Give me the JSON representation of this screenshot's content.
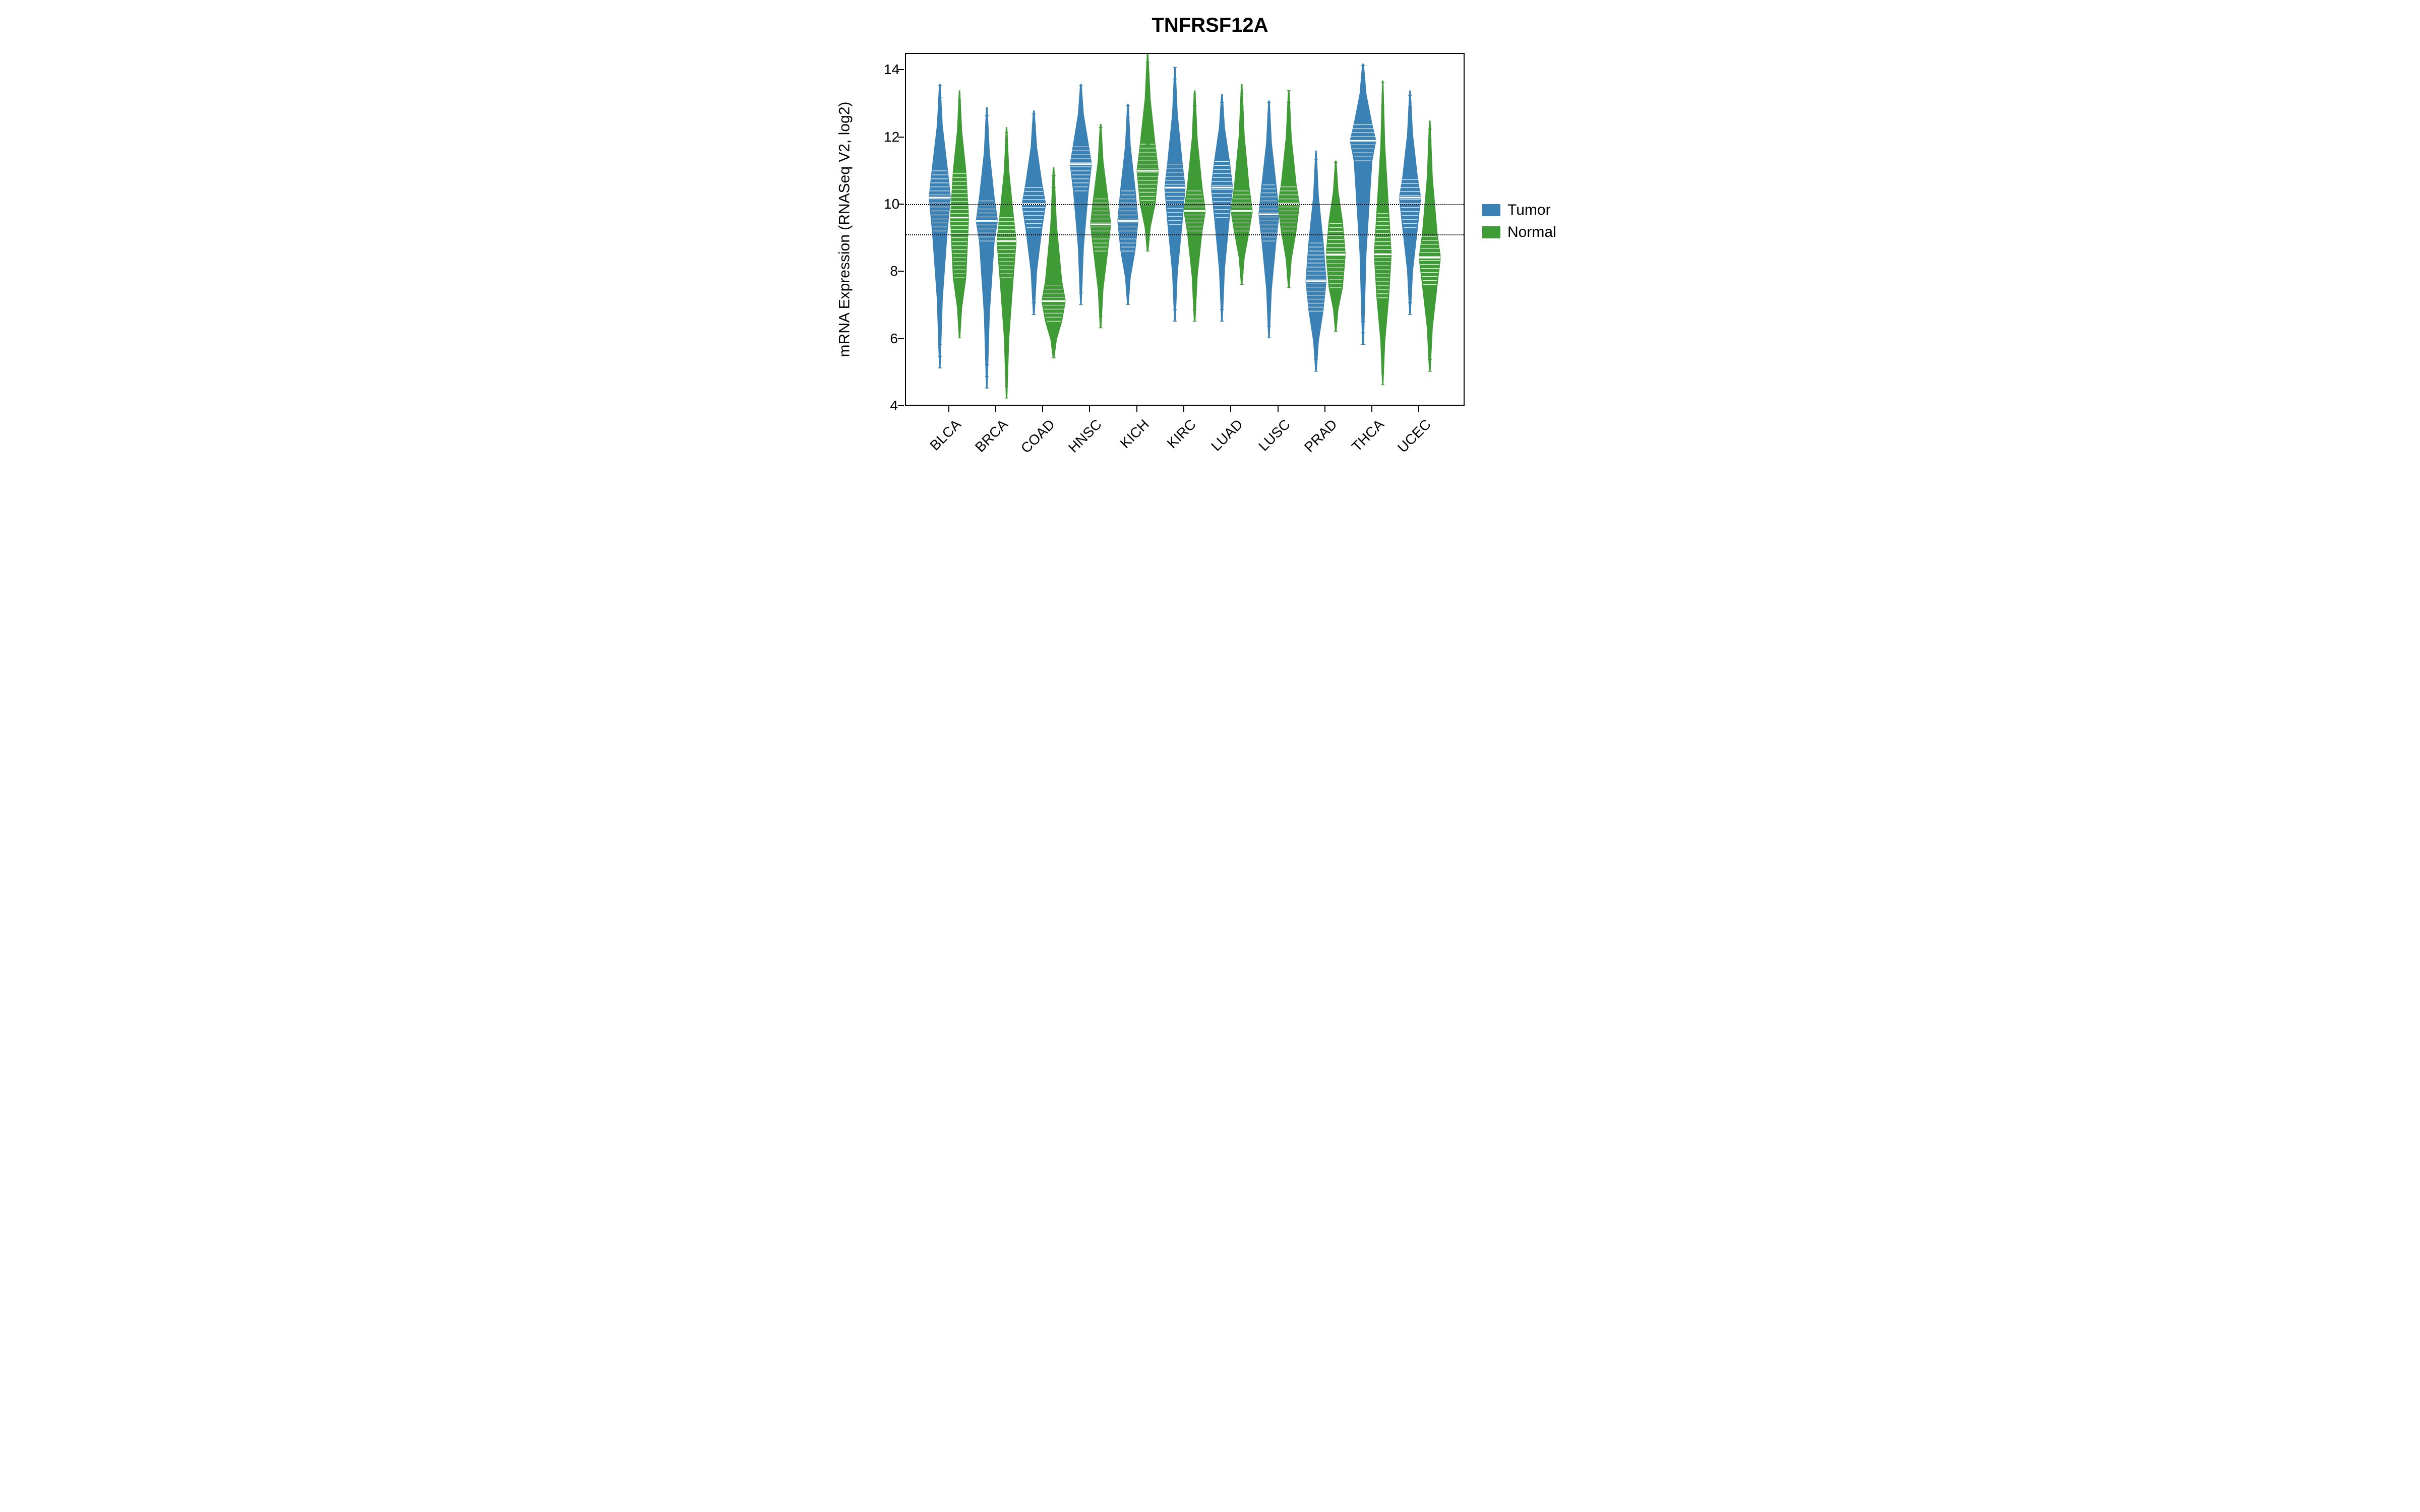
{
  "chart_data": {
    "type": "violin",
    "title": "TNFRSF12A",
    "ylabel": "mRNA Expression (RNASeq V2, log2)",
    "xlabel": "",
    "ylim": [
      4,
      14.5
    ],
    "y_ticks": [
      4,
      6,
      8,
      10,
      12,
      14
    ],
    "reference_lines": [
      10.0,
      9.1
    ],
    "categories": [
      "BLCA",
      "BRCA",
      "COAD",
      "HNSC",
      "KICH",
      "KIRC",
      "LUAD",
      "LUSC",
      "PRAD",
      "THCA",
      "UCEC"
    ],
    "series": [
      {
        "name": "Tumor",
        "color": "#3a82b5",
        "distributions": [
          {
            "median": 10.2,
            "q1": 9.2,
            "q3": 11.1,
            "min": 5.1,
            "max": 13.6,
            "bulk_width": 1.0
          },
          {
            "median": 9.5,
            "q1": 8.9,
            "q3": 10.2,
            "min": 4.5,
            "max": 12.9,
            "bulk_width": 1.0
          },
          {
            "median": 10.0,
            "q1": 9.3,
            "q3": 10.6,
            "min": 6.7,
            "max": 12.8,
            "bulk_width": 1.1
          },
          {
            "median": 11.2,
            "q1": 10.4,
            "q3": 11.8,
            "min": 7.0,
            "max": 13.6,
            "bulk_width": 1.0
          },
          {
            "median": 9.5,
            "q1": 8.6,
            "q3": 10.5,
            "min": 7.0,
            "max": 13.0,
            "bulk_width": 0.95
          },
          {
            "median": 10.5,
            "q1": 9.4,
            "q3": 11.3,
            "min": 6.5,
            "max": 14.1,
            "bulk_width": 0.95
          },
          {
            "median": 10.5,
            "q1": 9.6,
            "q3": 11.3,
            "min": 6.5,
            "max": 13.3,
            "bulk_width": 1.0
          },
          {
            "median": 9.7,
            "q1": 8.9,
            "q3": 10.6,
            "min": 6.0,
            "max": 13.1,
            "bulk_width": 0.95
          },
          {
            "median": 7.7,
            "q1": 6.8,
            "q3": 8.9,
            "min": 5.0,
            "max": 11.6,
            "bulk_width": 0.95
          },
          {
            "median": 11.9,
            "q1": 11.3,
            "q3": 12.4,
            "min": 5.8,
            "max": 14.2,
            "bulk_width": 1.2
          },
          {
            "median": 10.2,
            "q1": 9.3,
            "q3": 10.8,
            "min": 6.7,
            "max": 13.4,
            "bulk_width": 1.0
          }
        ]
      },
      {
        "name": "Normal",
        "color": "#3f9b35",
        "distributions": [
          {
            "median": 9.6,
            "q1": 7.8,
            "q3": 11.0,
            "min": 6.0,
            "max": 13.4,
            "bulk_width": 0.85
          },
          {
            "median": 8.9,
            "q1": 7.8,
            "q3": 9.7,
            "min": 4.2,
            "max": 12.3,
            "bulk_width": 0.9
          },
          {
            "median": 7.1,
            "q1": 6.5,
            "q3": 7.7,
            "min": 5.4,
            "max": 11.1,
            "bulk_width": 1.1
          },
          {
            "median": 9.4,
            "q1": 8.6,
            "q3": 10.2,
            "min": 6.3,
            "max": 12.4,
            "bulk_width": 0.95
          },
          {
            "median": 11.0,
            "q1": 10.0,
            "q3": 11.8,
            "min": 8.6,
            "max": 14.5,
            "bulk_width": 1.0
          },
          {
            "median": 9.8,
            "q1": 9.2,
            "q3": 10.5,
            "min": 6.5,
            "max": 13.4,
            "bulk_width": 1.0
          },
          {
            "median": 9.8,
            "q1": 9.2,
            "q3": 10.5,
            "min": 7.6,
            "max": 13.6,
            "bulk_width": 1.0
          },
          {
            "median": 10.0,
            "q1": 9.2,
            "q3": 10.6,
            "min": 7.5,
            "max": 13.4,
            "bulk_width": 1.0
          },
          {
            "median": 8.5,
            "q1": 7.5,
            "q3": 9.5,
            "min": 6.2,
            "max": 11.3,
            "bulk_width": 0.9
          },
          {
            "median": 8.5,
            "q1": 7.2,
            "q3": 9.8,
            "min": 4.6,
            "max": 13.7,
            "bulk_width": 0.8
          },
          {
            "median": 8.4,
            "q1": 7.6,
            "q3": 9.1,
            "min": 5.0,
            "max": 12.5,
            "bulk_width": 1.0
          }
        ]
      }
    ],
    "legend": {
      "entries": [
        {
          "label": "Tumor",
          "color": "#3a82b5"
        },
        {
          "label": "Normal",
          "color": "#3f9b35"
        }
      ]
    }
  }
}
